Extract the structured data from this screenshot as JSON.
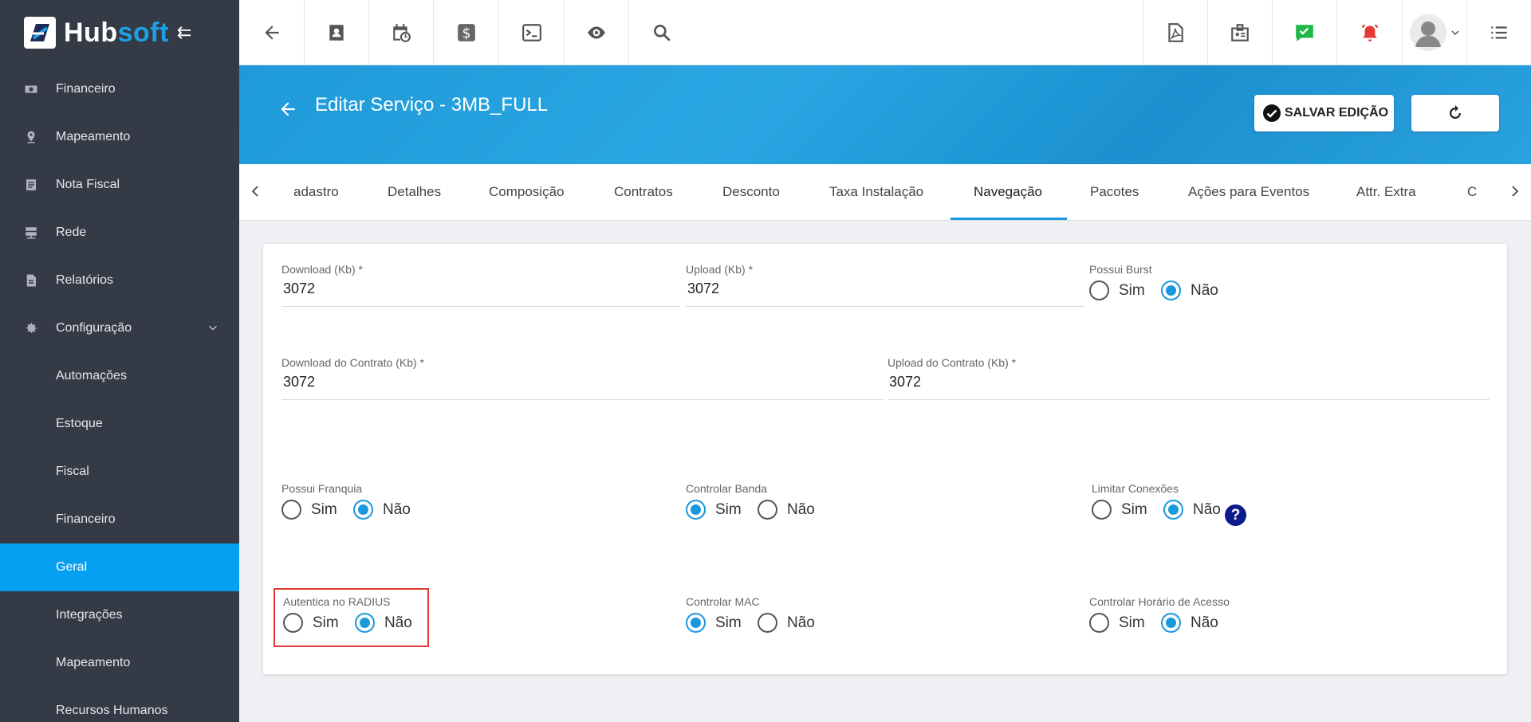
{
  "app": {
    "brand_main": "Hub",
    "brand_accent": "soft",
    "accent_color": "#079ff0"
  },
  "sidebar": {
    "items": [
      {
        "label": "Financeiro",
        "icon": "money-icon"
      },
      {
        "label": "Mapeamento",
        "icon": "map-pin-icon"
      },
      {
        "label": "Nota Fiscal",
        "icon": "invoice-icon"
      },
      {
        "label": "Rede",
        "icon": "server-icon"
      },
      {
        "label": "Relatórios",
        "icon": "report-icon"
      },
      {
        "label": "Configuração",
        "icon": "gear-icon"
      }
    ],
    "sub_items": [
      {
        "label": "Automações"
      },
      {
        "label": "Estoque"
      },
      {
        "label": "Fiscal"
      },
      {
        "label": "Financeiro"
      },
      {
        "label": "Geral"
      },
      {
        "label": "Integrações"
      },
      {
        "label": "Mapeamento"
      },
      {
        "label": "Recursos Humanos"
      }
    ],
    "active": "Geral"
  },
  "header": {
    "title": "Editar Serviço - 3MB_FULL",
    "save_label": "SALVAR EDIÇÃO"
  },
  "tabs": {
    "items": [
      "adastro",
      "Detalhes",
      "Composição",
      "Contratos",
      "Desconto",
      "Taxa Instalação",
      "Navegação",
      "Pacotes",
      "Ações para Eventos",
      "Attr. Extra",
      "C"
    ],
    "active": "Navegação"
  },
  "form": {
    "download": {
      "label": "Download (Kb) *",
      "value": "3072"
    },
    "upload": {
      "label": "Upload (Kb) *",
      "value": "3072"
    },
    "possui_burst": {
      "label": "Possui Burst",
      "sim": "Sim",
      "nao": "Não",
      "selected": "Não"
    },
    "download_contrato": {
      "label": "Download do Contrato (Kb) *",
      "value": "3072"
    },
    "upload_contrato": {
      "label": "Upload do Contrato (Kb) *",
      "value": "3072"
    },
    "possui_franquia": {
      "label": "Possui Franquia",
      "sim": "Sim",
      "nao": "Não",
      "selected": "Não"
    },
    "controlar_banda": {
      "label": "Controlar Banda",
      "sim": "Sim",
      "nao": "Não",
      "selected": "Sim"
    },
    "limitar_conexoes": {
      "label": "Limitar Conexões",
      "sim": "Sim",
      "nao": "Não",
      "selected": "Não",
      "help": "?"
    },
    "autentica_radius": {
      "label": "Autentica no RADIUS",
      "sim": "Sim",
      "nao": "Não",
      "selected": "Não"
    },
    "controlar_mac": {
      "label": "Controlar MAC",
      "sim": "Sim",
      "nao": "Não",
      "selected": "Sim"
    },
    "controlar_horario": {
      "label": "Controlar Horário de Acesso",
      "sim": "Sim",
      "nao": "Não",
      "selected": "Não"
    }
  }
}
